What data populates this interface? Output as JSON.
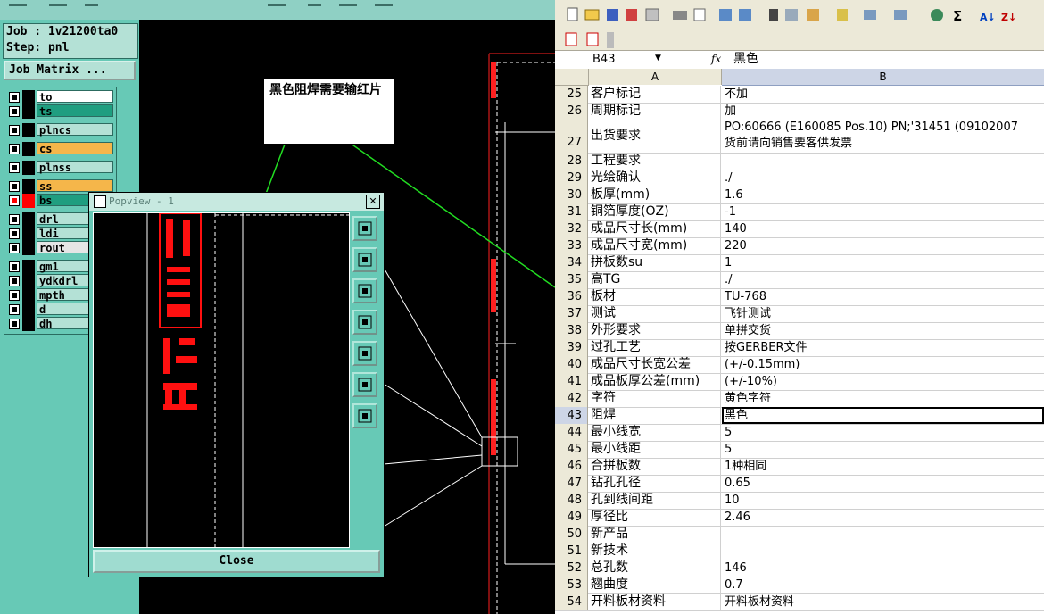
{
  "cam": {
    "job_label": "Job : 1v21200ta0",
    "step_label": "Step: pnl",
    "job_matrix_button": "Job Matrix ...",
    "layers": [
      {
        "name": "to",
        "color": "#ffffff",
        "state": "black"
      },
      {
        "name": "ts",
        "color": "#1f9e80",
        "state": "black"
      },
      {
        "name": "plncs",
        "color": "#b4e1d6",
        "state": "black"
      },
      {
        "name": "cs",
        "color": "#f5b64a",
        "state": "black"
      },
      {
        "name": "plnss",
        "color": "#b4e1d6",
        "state": "black"
      },
      {
        "name": "ss",
        "color": "#f5b64a",
        "state": "black"
      },
      {
        "name": "bs",
        "color": "#1f9e80",
        "state": "red"
      },
      {
        "name": "drl",
        "color": "#b4e1d6",
        "state": "black"
      },
      {
        "name": "ldi",
        "color": "#b4e1d6",
        "state": "black"
      },
      {
        "name": "rout",
        "color": "#e5e5e5",
        "state": "black"
      },
      {
        "name": "gm1",
        "color": "#b4e1d6",
        "state": "black"
      },
      {
        "name": "ydkdrl",
        "color": "#b4e1d6",
        "state": "black"
      },
      {
        "name": "mpth",
        "color": "#b4e1d6",
        "state": "black"
      },
      {
        "name": "d",
        "color": "#b4e1d6",
        "state": "black"
      },
      {
        "name": "dh",
        "color": "#b4e1d6",
        "state": "black"
      }
    ],
    "annotation_text": "黑色阻焊需要输红片",
    "popview": {
      "title": "Popview - 1",
      "close_button": "Close",
      "tool_icons": [
        "fit-icon",
        "move-up-icon",
        "move-down-icon",
        "move-left-icon",
        "move-right-icon",
        "zoom-in-icon",
        "zoom-out-icon"
      ]
    }
  },
  "excel": {
    "name_box": "B43",
    "fx_label": "fx",
    "formula_value": "黑色",
    "col_a": "A",
    "col_b": "B",
    "rows": [
      {
        "n": "25",
        "a": "客户标记",
        "b": "不加"
      },
      {
        "n": "26",
        "a": "周期标记",
        "b": "加"
      },
      {
        "n": "27",
        "a": "出货要求",
        "b": "PO:60666 (E160085 Pos.10) PN;'31451 (09102007",
        "b2": "货前请向销售要客供发票"
      },
      {
        "n": "28",
        "a": "工程要求",
        "b": ""
      },
      {
        "n": "29",
        "a": "光绘确认",
        "b": "./"
      },
      {
        "n": "30",
        "a": "板厚(mm)",
        "b": "1.6"
      },
      {
        "n": "31",
        "a": "铜箔厚度(OZ)",
        "b": "-1"
      },
      {
        "n": "32",
        "a": "成品尺寸长(mm)",
        "b": "140"
      },
      {
        "n": "33",
        "a": "成品尺寸宽(mm)",
        "b": "220"
      },
      {
        "n": "34",
        "a": "拼板数su",
        "b": "1"
      },
      {
        "n": "35",
        "a": "高TG",
        "b": "./"
      },
      {
        "n": "36",
        "a": "板材",
        "b": "TU-768"
      },
      {
        "n": "37",
        "a": "测试",
        "b": "飞针测试"
      },
      {
        "n": "38",
        "a": "外形要求",
        "b": "单拼交货"
      },
      {
        "n": "39",
        "a": "过孔工艺",
        "b": "按GERBER文件"
      },
      {
        "n": "40",
        "a": "成品尺寸长宽公差",
        "b": "(+/-0.15mm)"
      },
      {
        "n": "41",
        "a": "成品板厚公差(mm)",
        "b": "(+/-10%)"
      },
      {
        "n": "42",
        "a": "字符",
        "b": "黄色字符"
      },
      {
        "n": "43",
        "a": "阻焊",
        "b": "黑色"
      },
      {
        "n": "44",
        "a": "最小线宽",
        "b": "5"
      },
      {
        "n": "45",
        "a": "最小线距",
        "b": "5"
      },
      {
        "n": "46",
        "a": "合拼板数",
        "b": "1种相同"
      },
      {
        "n": "47",
        "a": "钻孔孔径",
        "b": "0.65"
      },
      {
        "n": "48",
        "a": "孔到线间距",
        "b": "10"
      },
      {
        "n": "49",
        "a": "厚径比",
        "b": "2.46"
      },
      {
        "n": "50",
        "a": "新产品",
        "b": ""
      },
      {
        "n": "51",
        "a": "新技术",
        "b": ""
      },
      {
        "n": "52",
        "a": "总孔数",
        "b": "146"
      },
      {
        "n": "53",
        "a": "翘曲度",
        "b": "0.7"
      },
      {
        "n": "54",
        "a": "开料板材资料",
        "b": "开料板材资料"
      }
    ],
    "selected_row": "43"
  }
}
